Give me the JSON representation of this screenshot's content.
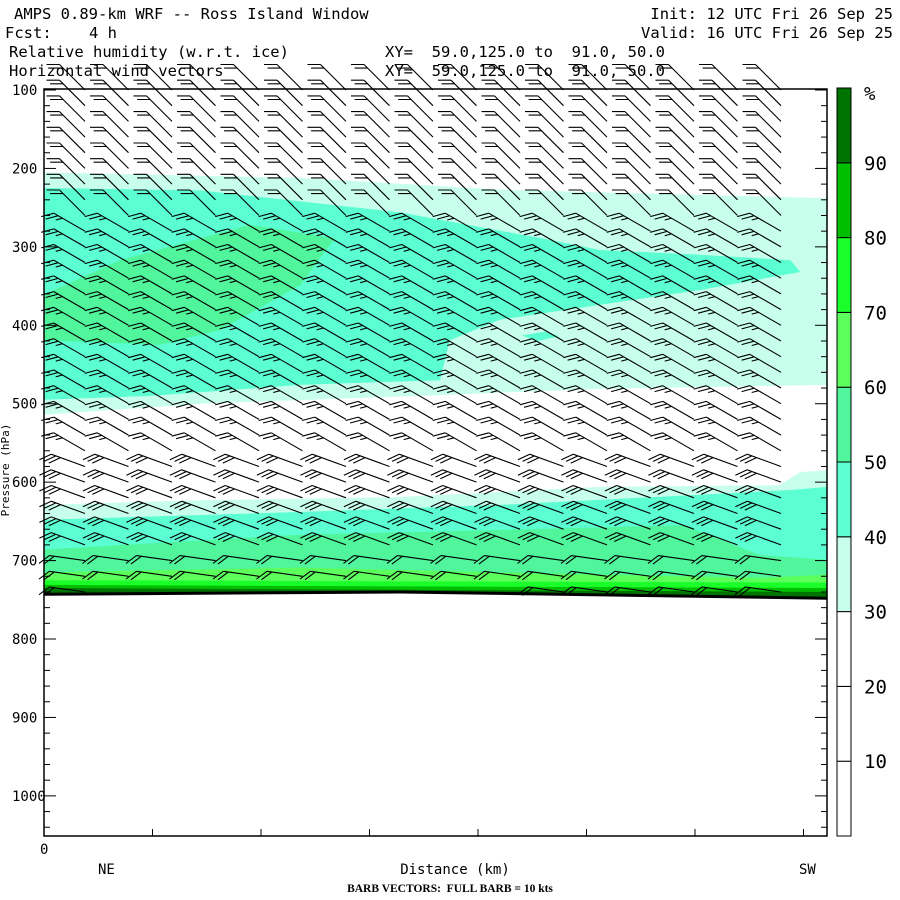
{
  "header": {
    "title": "AMPS 0.89-km WRF -- Ross Island Window",
    "init": "Init: 12 UTC Fri 26 Sep 25",
    "fcst": "Fcst:    4 h",
    "valid": "Valid: 16 UTC Fri 26 Sep 25",
    "field1": "Relative humidity (w.r.t. ice)",
    "field1_xy": "XY=  59.0,125.0 to  91.0, 50.0",
    "field2": "Horizontal wind vectors",
    "field2_xy": "XY=  59.0,125.0 to  91.0, 50.0"
  },
  "chart_data": {
    "type": "heatmap",
    "title": "Relative humidity (w.r.t. ice) cross-section with wind barbs",
    "xlabel": "Distance (km)",
    "x_origin_label": "0",
    "x_left_label": "NE",
    "x_right_label": "SW",
    "x_units": "tick intervals",
    "xlim": [
      0,
      7.22
    ],
    "x_ticks": [
      0,
      1,
      2,
      3,
      4,
      5,
      6,
      7
    ],
    "ylabel": "Pressure (hPa)",
    "ylim": [
      100,
      1050
    ],
    "y_ticks": [
      "100",
      "200",
      "300",
      "400",
      "500",
      "600",
      "700",
      "800",
      "900",
      "1000"
    ],
    "y_tick_values": [
      100,
      200,
      300,
      400,
      500,
      600,
      700,
      800,
      900,
      1000
    ],
    "colorbar": {
      "unit": "%",
      "levels": [
        0,
        10,
        20,
        30,
        40,
        50,
        60,
        70,
        80,
        90,
        100
      ],
      "labels": [
        "10",
        "20",
        "30",
        "40",
        "50",
        "60",
        "70",
        "80",
        "90"
      ],
      "colors": [
        "#ffffff",
        "#ffffff",
        "#ffffff",
        "#c8ffec",
        "#5cffd2",
        "#50f59c",
        "#5cff5c",
        "#1aff2a",
        "#00bf00",
        "#007400"
      ]
    },
    "rh_regions": [
      {
        "min_rh": 30,
        "color": "#c8ffec",
        "polygon": [
          [
            0,
            205
          ],
          [
            2.36,
            212
          ],
          [
            4.2,
            227
          ],
          [
            7.22,
            238
          ],
          [
            7.22,
            476
          ],
          [
            5.12,
            481
          ],
          [
            3.65,
            489
          ],
          [
            1.44,
            500
          ],
          [
            0,
            514
          ]
        ]
      },
      {
        "min_rh": 40,
        "color": "#5cffd2",
        "polygon": [
          [
            0,
            225
          ],
          [
            1.44,
            228
          ],
          [
            3.28,
            256
          ],
          [
            4.66,
            291
          ],
          [
            5.12,
            304
          ],
          [
            6.05,
            310
          ],
          [
            6.88,
            317
          ],
          [
            6.97,
            332
          ],
          [
            6.05,
            355
          ],
          [
            5.12,
            374
          ],
          [
            4.2,
            393
          ],
          [
            3.74,
            419
          ],
          [
            3.65,
            470
          ],
          [
            2.36,
            476
          ],
          [
            0.98,
            490
          ],
          [
            0,
            495
          ]
        ]
      },
      {
        "min_rh": 50,
        "color": "#50f59c",
        "polygon": [
          [
            0,
            361
          ],
          [
            0.7,
            317
          ],
          [
            1.9,
            272
          ],
          [
            2.68,
            289
          ],
          [
            2.36,
            349
          ],
          [
            1.62,
            406
          ],
          [
            1.07,
            425
          ],
          [
            0,
            419
          ]
        ]
      },
      {
        "min_rh": 40,
        "color": "#5cffd2",
        "polygon": [
          [
            4.4,
            413
          ],
          [
            4.62,
            408
          ],
          [
            4.75,
            414
          ],
          [
            4.55,
            420
          ]
        ]
      },
      {
        "min_rh": 30,
        "color": "#c8ffec",
        "top": [
          [
            0,
            629
          ],
          [
            1.44,
            623
          ],
          [
            3.28,
            619
          ],
          [
            5.12,
            606
          ],
          [
            6.78,
            604
          ],
          [
            6.97,
            587
          ],
          [
            7.22,
            585
          ]
        ]
      },
      {
        "min_rh": 40,
        "color": "#5cffd2",
        "top": [
          [
            0,
            648
          ],
          [
            2.36,
            638
          ],
          [
            4.2,
            629
          ],
          [
            6.05,
            616
          ],
          [
            6.88,
            610
          ],
          [
            7.22,
            606
          ]
        ]
      },
      {
        "min_rh": 50,
        "color": "#50f59c",
        "top": [
          [
            0,
            686
          ],
          [
            2.36,
            667
          ],
          [
            4.2,
            661
          ],
          [
            5.9,
            655
          ],
          [
            6.6,
            693
          ],
          [
            7.22,
            699
          ]
        ]
      },
      {
        "min_rh": 60,
        "color": "#5cff5c",
        "top": [
          [
            0,
            715
          ],
          [
            2.36,
            709
          ],
          [
            5.12,
            718
          ],
          [
            6.6,
            722
          ],
          [
            7.22,
            718
          ]
        ]
      },
      {
        "min_rh": 70,
        "color": "#1aff2a",
        "top": [
          [
            0,
            725
          ],
          [
            7.22,
            728
          ]
        ]
      },
      {
        "min_rh": 80,
        "color": "#00bf00",
        "top": [
          [
            0,
            731
          ],
          [
            7.22,
            735
          ]
        ]
      },
      {
        "min_rh": 90,
        "color": "#007400",
        "top": [
          [
            0,
            735
          ],
          [
            7.22,
            740
          ]
        ]
      }
    ],
    "terrain_surface": [
      [
        0,
        743
      ],
      [
        3.28,
        740
      ],
      [
        7.22,
        748
      ]
    ],
    "wind_barbs": {
      "note": "BARB VECTORS:  FULL BARB = 10 kts",
      "columns": 17,
      "level_step_hpa": 20,
      "layers": [
        {
          "p_top": 100,
          "p_bottom": 250,
          "direction_deg": 315,
          "speed_kt": 20
        },
        {
          "p_top": 260,
          "p_bottom": 560,
          "direction_deg": 300,
          "speed_kt": 25
        },
        {
          "p_top": 580,
          "p_bottom": 680,
          "direction_deg": 290,
          "speed_kt": 30
        },
        {
          "p_top": 700,
          "p_bottom": 750,
          "direction_deg": 278,
          "speed_kt": 20
        }
      ]
    }
  }
}
